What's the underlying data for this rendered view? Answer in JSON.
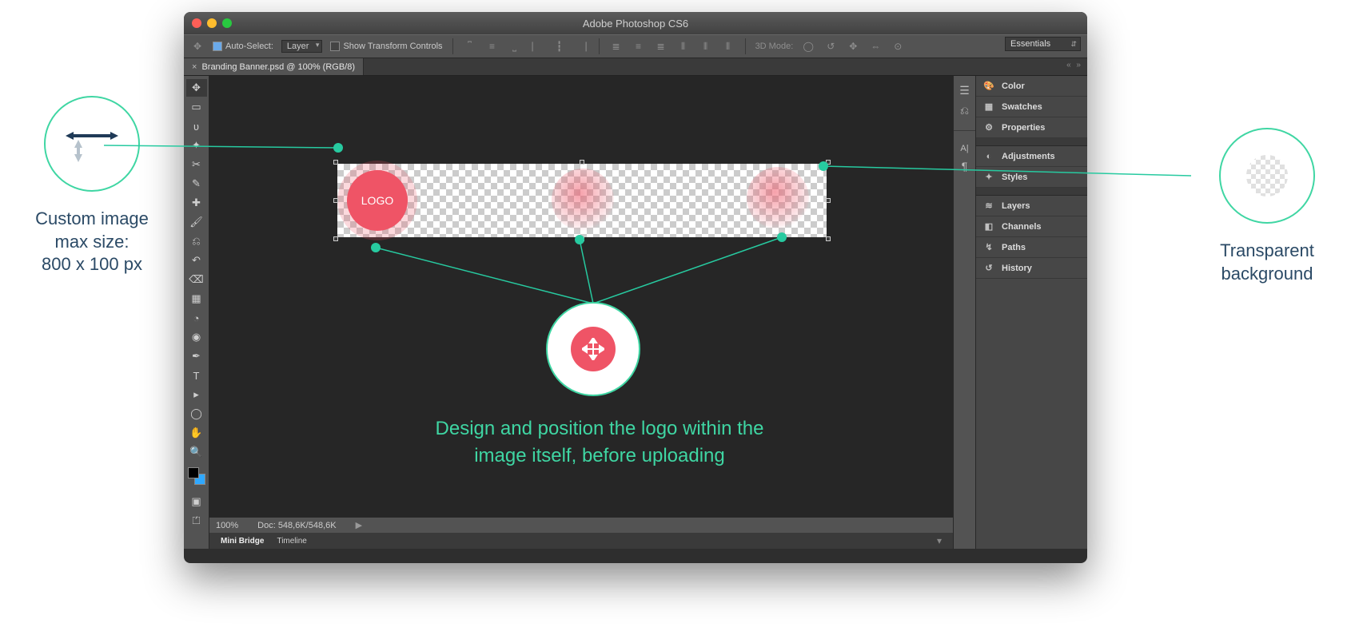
{
  "annotations": {
    "left_label_line1": "Custom image",
    "left_label_line2": "max size:",
    "left_label_line3": "800 x 100 px",
    "right_label_line1": "Transparent",
    "right_label_line2": "background",
    "center_caption_line1": "Design and position the logo within the",
    "center_caption_line2": "image itself, before uploading"
  },
  "window": {
    "title": "Adobe Photoshop CS6"
  },
  "options_bar": {
    "auto_select_label": "Auto-Select:",
    "auto_select_value": "Layer",
    "show_transform_label": "Show Transform Controls",
    "mode3d_label": "3D Mode:"
  },
  "workspace_switcher": "Essentials",
  "document_tab": {
    "label": "Branding Banner.psd @ 100% (RGB/8)"
  },
  "canvas": {
    "logo_text": "LOGO"
  },
  "status_bar": {
    "zoom": "100%",
    "doc_info": "Doc: 548,6K/548,6K"
  },
  "bottom_tabs": {
    "mini_bridge": "Mini Bridge",
    "timeline": "Timeline"
  },
  "panels": {
    "color": "Color",
    "swatches": "Swatches",
    "properties": "Properties",
    "adjustments": "Adjustments",
    "styles": "Styles",
    "layers": "Layers",
    "channels": "Channels",
    "paths": "Paths",
    "history": "History"
  }
}
